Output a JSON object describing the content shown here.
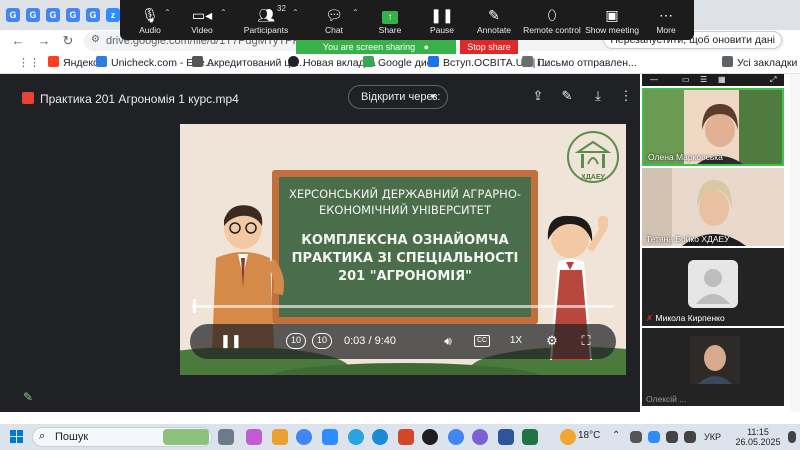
{
  "browser": {
    "url": "drive.google.com/file/d/1T7PdgMTyTPRa138WcW",
    "update_button": "Перезапустити, щоб оновити дані",
    "bookmarks": [
      {
        "label": "Яндекс",
        "color": "#fc3f1d"
      },
      {
        "label": "Unicheck.com - Effe...",
        "color": "#2f7de1"
      },
      {
        "label": "Акредитований це...",
        "color": "#555555"
      },
      {
        "label": "Новая вкладка",
        "color": "#202124"
      },
      {
        "label": "Google диск",
        "color": "#34a853"
      },
      {
        "label": "Вступ.ОСВІТА.UA | i...",
        "color": "#1a73e8"
      },
      {
        "label": "Письмо отправлен...",
        "color": "#6d6d6d"
      }
    ],
    "all_bookmarks": "Усі закладки"
  },
  "zoom": {
    "participants_count": "32",
    "buttons": [
      {
        "label": "Audio",
        "icon": "microphone-icon"
      },
      {
        "label": "Video",
        "icon": "video-camera-icon"
      },
      {
        "label": "Participants",
        "icon": "participants-icon"
      },
      {
        "label": "Chat",
        "icon": "chat-icon"
      },
      {
        "label": "Share",
        "icon": "share-screen-icon"
      },
      {
        "label": "Pause",
        "icon": "pause-icon"
      },
      {
        "label": "Annotate",
        "icon": "pencil-icon"
      },
      {
        "label": "Remote control",
        "icon": "mouse-icon"
      },
      {
        "label": "Show meeting",
        "icon": "window-icon"
      },
      {
        "label": "More",
        "icon": "more-icon"
      }
    ],
    "sharing_banner": "You are screen sharing",
    "stop_share": "Stop share",
    "gallery": [
      {
        "name": "Олена Марковська"
      },
      {
        "name": "Тетяна Бойко ХДАЕУ"
      },
      {
        "name": "Микола Кирпенко"
      },
      {
        "name": "Олексій ..."
      }
    ]
  },
  "drive": {
    "file_name": "Практика 201 Агрономія 1 курс.mp4",
    "open_with": "Відкрити через:",
    "colors": {
      "bg": "#202124",
      "accent": "#81c995"
    }
  },
  "video": {
    "title_lines": [
      "ХЕРСОНСЬКИЙ ДЕРЖАВНИЙ АГРАРНО-",
      "ЕКОНОМІЧНИЙ УНІВЕРСИТЕТ",
      "КОМПЛЕКСНА ОЗНАЙОМЧА",
      "ПРАКТИКА ЗІ СПЕЦІАЛЬНОСТІ",
      "201 \"АГРОНОМІЯ\""
    ],
    "logo_text": "ХДАЕУ",
    "current_time": "0:03",
    "duration": "9:40",
    "time_display": "0:03 / 9:40",
    "progress": 0.005,
    "speed": "1X",
    "rewind_label": "10",
    "forward_label": "10"
  },
  "taskbar": {
    "search": "Пошук",
    "temperature": "18°C",
    "language": "УКР",
    "time": "11:15",
    "date": "26.05.2025"
  }
}
